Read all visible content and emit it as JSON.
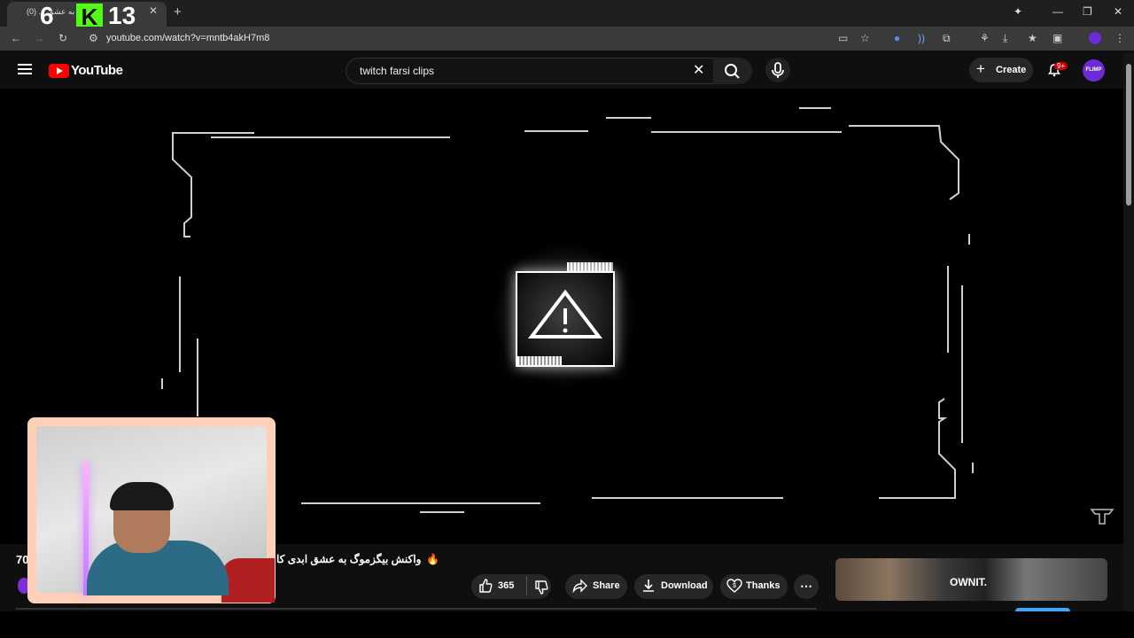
{
  "browser": {
    "tab_title": "به عشق ... (0)",
    "url": "youtube.com/watch?v=mntb4akH7m8",
    "new_tab_glyph": "+",
    "close_glyph": "✕"
  },
  "overlay": {
    "counter_left": "6",
    "counter_right": "13",
    "k_logo": "K"
  },
  "youtube": {
    "logo_text": "YouTube",
    "search_value": "twitch farsi clips",
    "create_label": "Create",
    "notif_count": "9+",
    "avatar_text": "FLIMP"
  },
  "video": {
    "title": "واکنش بیگزموگ به عشق ابدی کا",
    "title_prefix": "70",
    "emoji": "🔥",
    "likes": "365",
    "actions": {
      "share": "Share",
      "download": "Download",
      "thanks": "Thanks"
    }
  },
  "ad": {
    "thumb_text": "OWNIT."
  }
}
